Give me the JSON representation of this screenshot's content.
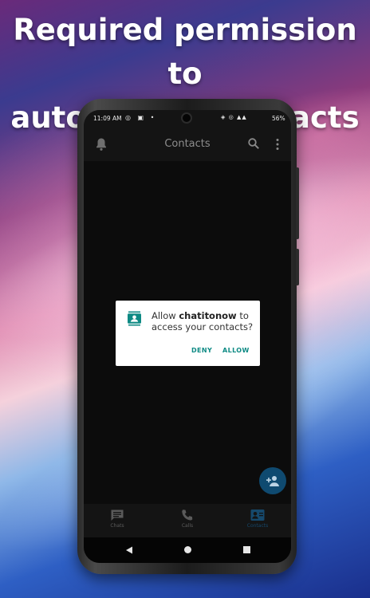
{
  "headline": {
    "line1": "Required permission to",
    "line2": "auto import contacts"
  },
  "status_bar": {
    "time": "11:09 AM",
    "left_icons": "◎ ▣ •",
    "right_icons": "◈ ◎ ▲▲",
    "battery": "56%"
  },
  "app_bar": {
    "title": "Contacts",
    "left_icon": "bell-icon",
    "right_icons": [
      "search-icon",
      "more-vert-icon"
    ]
  },
  "permission_dialog": {
    "prefix": "Allow ",
    "app_name": "chatitonow",
    "suffix": " to access your contacts?",
    "icon": "contacts-icon",
    "deny_label": "DENY",
    "allow_label": "ALLOW",
    "accent_color": "#0e8a84"
  },
  "fab": {
    "icon": "add-person-icon",
    "color": "#0f4a70"
  },
  "bottom_nav": {
    "tabs": [
      {
        "label": "Chats",
        "icon": "chat-icon"
      },
      {
        "label": "Calls",
        "icon": "phone-icon"
      },
      {
        "label": "Contacts",
        "icon": "contacts-icon",
        "selected": true
      }
    ]
  },
  "system_nav": [
    "back-icon",
    "home-icon",
    "recents-icon"
  ]
}
